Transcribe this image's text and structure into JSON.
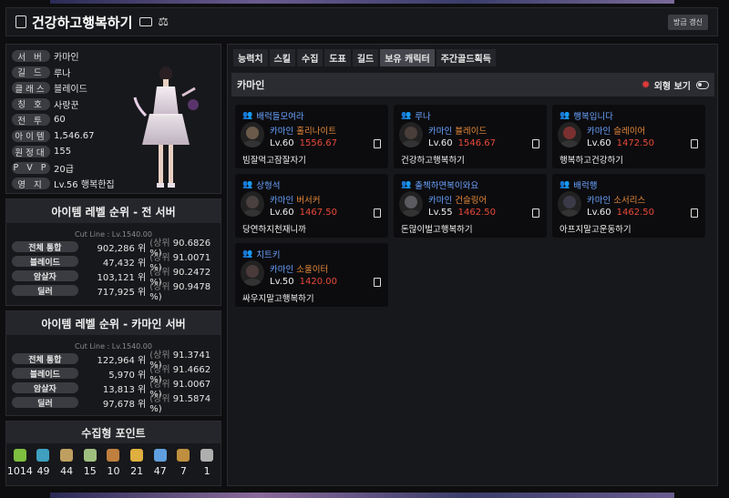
{
  "header": {
    "title": "건강하고행복하기",
    "refresh": "방금 갱신"
  },
  "profile": [
    {
      "label": "서 버",
      "value": "카마인"
    },
    {
      "label": "길 드",
      "value": "루나"
    },
    {
      "label": "클래스",
      "value": "블레이드"
    },
    {
      "label": "칭 호",
      "value": "사랑꾼"
    },
    {
      "label": "전 투",
      "value": "60"
    },
    {
      "label": "아이템",
      "value": "1,546.67"
    },
    {
      "label": "원정대",
      "value": "155"
    },
    {
      "label": "P V P",
      "value": "20급"
    },
    {
      "label": "영 지",
      "value": "Lv.56 행복한집"
    }
  ],
  "rank_all": {
    "title": "아이템 레벨 순위 - 전 서버",
    "cutline": "Cut Line : Lv.1540.00",
    "rows": [
      {
        "label": "전체 통합",
        "rank": "902,286 위",
        "pct": "90.6826 %)"
      },
      {
        "label": "블레이드",
        "rank": "47,432 위",
        "pct": "91.0071 %)"
      },
      {
        "label": "암살자",
        "rank": "103,121 위",
        "pct": "90.2472 %)"
      },
      {
        "label": "딜러",
        "rank": "717,925 위",
        "pct": "90.9478 %)"
      }
    ]
  },
  "rank_server": {
    "title": "아이템 레벨 순위 - 카마인 서버",
    "cutline": "Cut Line : Lv.1540.00",
    "rows": [
      {
        "label": "전체 통합",
        "rank": "122,964 위",
        "pct": "91.3741 %)"
      },
      {
        "label": "블레이드",
        "rank": "5,970 위",
        "pct": "91.4662 %)"
      },
      {
        "label": "암살자",
        "rank": "13,813 위",
        "pct": "91.0067 %)"
      },
      {
        "label": "딜러",
        "rank": "97,678 위",
        "pct": "91.5874 %)"
      }
    ]
  },
  "rank_prefix": "(상위",
  "collect": {
    "title": "수집형 포인트",
    "items": [
      {
        "icon": "seed-icon",
        "value": "1014",
        "color": "#7fbf3f"
      },
      {
        "icon": "island-icon",
        "value": "49",
        "color": "#3fa0bf"
      },
      {
        "icon": "art-icon",
        "value": "44",
        "color": "#bf9f5f"
      },
      {
        "icon": "mococo-icon",
        "value": "15",
        "color": "#9fbf7f"
      },
      {
        "icon": "giant-heart-icon",
        "value": "10",
        "color": "#bf7f3f"
      },
      {
        "icon": "ignea-icon",
        "value": "21",
        "color": "#dfaf3f"
      },
      {
        "icon": "orpheus-star-icon",
        "value": "47",
        "color": "#5f9fdf"
      },
      {
        "icon": "world-tree-icon",
        "value": "7",
        "color": "#bf8f3f"
      },
      {
        "icon": "sea-bounty-icon",
        "value": "1",
        "color": "#afafaf"
      }
    ]
  },
  "tabs": [
    "능력치",
    "스킬",
    "수집",
    "도표",
    "길드",
    "보유 캐릭터",
    "주간골드획득"
  ],
  "active_tab": 5,
  "server_bar": {
    "name": "카마인",
    "toggle": "외형 보기"
  },
  "characters": [
    {
      "guild": "배럭들모여라",
      "server": "카마인",
      "cls": "홀리나이트",
      "lv": "Lv.60",
      "il": "1556.67",
      "name": "빔잘먹고잠잘자기"
    },
    {
      "guild": "루나",
      "server": "카마인",
      "cls": "블레이드",
      "lv": "Lv.60",
      "il": "1546.67",
      "name": "건강하고행복하기"
    },
    {
      "guild": "행복입니다",
      "server": "카마인",
      "cls": "슬레이어",
      "lv": "Lv.60",
      "il": "1472.50",
      "name": "행복하고건강하기"
    },
    {
      "guild": "상형석",
      "server": "카마인",
      "cls": "버서커",
      "lv": "Lv.60",
      "il": "1467.50",
      "name": "당연하지천재니까"
    },
    {
      "guild": "출첵하면복이와요",
      "server": "카마인",
      "cls": "건슬링어",
      "lv": "Lv.55",
      "il": "1462.50",
      "name": "돈많이벌고행복하기"
    },
    {
      "guild": "배럭행",
      "server": "카마인",
      "cls": "소서리스",
      "lv": "Lv.60",
      "il": "1462.50",
      "name": "아프지말고운동하기"
    },
    {
      "guild": "치트키",
      "server": "카마인",
      "cls": "소울이터",
      "lv": "Lv.50",
      "il": "1420.00",
      "name": "싸우지말고행복하기"
    }
  ]
}
